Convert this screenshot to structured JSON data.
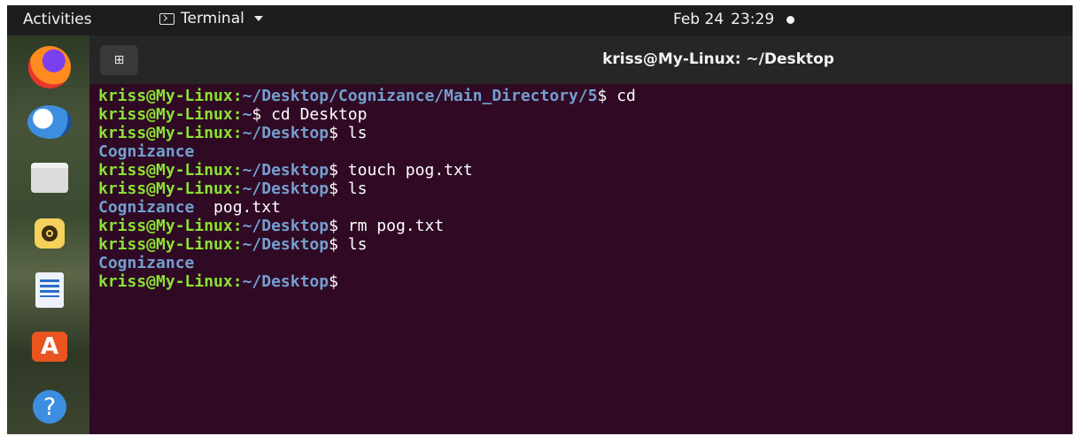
{
  "topbar": {
    "activities": "Activities",
    "app_menu_label": "Terminal",
    "date": "Feb 24",
    "time": "23:29"
  },
  "window": {
    "title": "kriss@My-Linux: ~/Desktop",
    "new_tab_glyph": "⊞"
  },
  "dock": {
    "items": [
      "firefox-icon",
      "thunderbird-icon",
      "files-icon",
      "rhythmbox-icon",
      "libreoffice-writer-icon",
      "software-icon",
      "help-icon"
    ]
  },
  "terminal": {
    "prompt_user": "kriss@My-Linux",
    "lines": [
      {
        "path": "~/Desktop/Cognizance/Main_Directory/5",
        "cmd": " cd"
      },
      {
        "path": "~",
        "cmd": " cd Desktop"
      },
      {
        "path": "~/Desktop",
        "cmd": " ls"
      },
      {
        "output_dir": "Cognizance"
      },
      {
        "path": "~/Desktop",
        "cmd": " touch pog.txt"
      },
      {
        "path": "~/Desktop",
        "cmd": " ls"
      },
      {
        "output_dir": "Cognizance",
        "output_file": "  pog.txt"
      },
      {
        "path": "~/Desktop",
        "cmd": " rm pog.txt"
      },
      {
        "path": "~/Desktop",
        "cmd": " ls"
      },
      {
        "output_dir": "Cognizance"
      },
      {
        "path": "~/Desktop",
        "cmd": ""
      }
    ]
  },
  "colors": {
    "terminal_bg": "#300a24",
    "user": "#8ae234",
    "path": "#729fcf"
  }
}
